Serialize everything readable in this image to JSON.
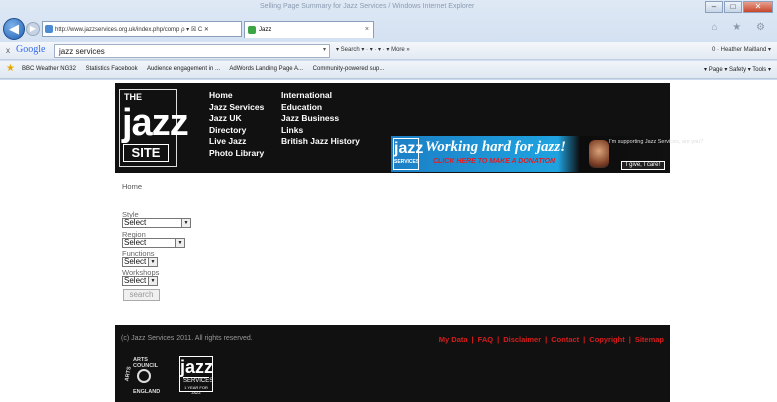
{
  "browser": {
    "title": "Selling Page Summary for Jazz Services / Windows Internet Explorer",
    "address": "http://www.jazzservices.org.uk/index.php/comp",
    "address_controls": "ρ ▾ ☒ C ✕",
    "tab_label": "Jazz",
    "tab_close": "×",
    "back": "◀",
    "forward": "▶",
    "window_buttons": [
      "–",
      "□",
      "✕"
    ],
    "nav_icons": "⌂ ★ ⚙"
  },
  "google_bar": {
    "close": "x",
    "logo": "Google",
    "search_value": "jazz services",
    "tools": "▾  Search ▾  ·  ▾  ·  ▾  ·  ▾  More »",
    "right": "Heather Maitland ▾",
    "account_badge": "0"
  },
  "favorites": {
    "items": [
      "BBC Weather NG32",
      "Statistics Facebook",
      "Audience engagement in ...",
      "AdWords Landing Page A...",
      "Community-powered sup..."
    ],
    "command_bar": "▾ Page ▾  Safety ▾  Tools ▾"
  },
  "site": {
    "logo": {
      "the": "THE",
      "jazz": "jazz",
      "site": "SITE"
    },
    "menu_col1": [
      "Home",
      "Jazz Services",
      "Jazz UK",
      "Directory",
      "Live Jazz",
      "Photo Library"
    ],
    "menu_col2": [
      "International",
      "Education",
      "Jazz Business",
      "Links",
      "British Jazz History"
    ],
    "banner": {
      "logo": "jazz",
      "logo_sub": "SERVICES",
      "headline": "Working hard for jazz!",
      "cta": "CLICK HERE TO MAKE A DONATION",
      "right_text": "I'm supporting Jazz Services, are you?",
      "button": "I give, I care!"
    }
  },
  "content": {
    "breadcrumb": "Home",
    "filters": [
      {
        "label": "Style",
        "value": "Select"
      },
      {
        "label": "Region",
        "value": "Select"
      },
      {
        "label": "Functions",
        "value": "Select"
      },
      {
        "label": "Workshops",
        "value": "Select"
      }
    ],
    "search_button": "search"
  },
  "footer": {
    "copyright": "(c) Jazz Services 2011. All rights reserved.",
    "links": [
      "My Data",
      "FAQ",
      "Disclaimer",
      "Contact",
      "Copyright",
      "Sitemap"
    ],
    "arts_council": {
      "top": "ARTS COUNCIL",
      "left": "ARTS",
      "bottom": "ENGLAND"
    },
    "jazz_logo": {
      "big": "jazz",
      "sub": "SERVICES",
      "tiny": "1 YEAR FOR JAZZ"
    }
  }
}
